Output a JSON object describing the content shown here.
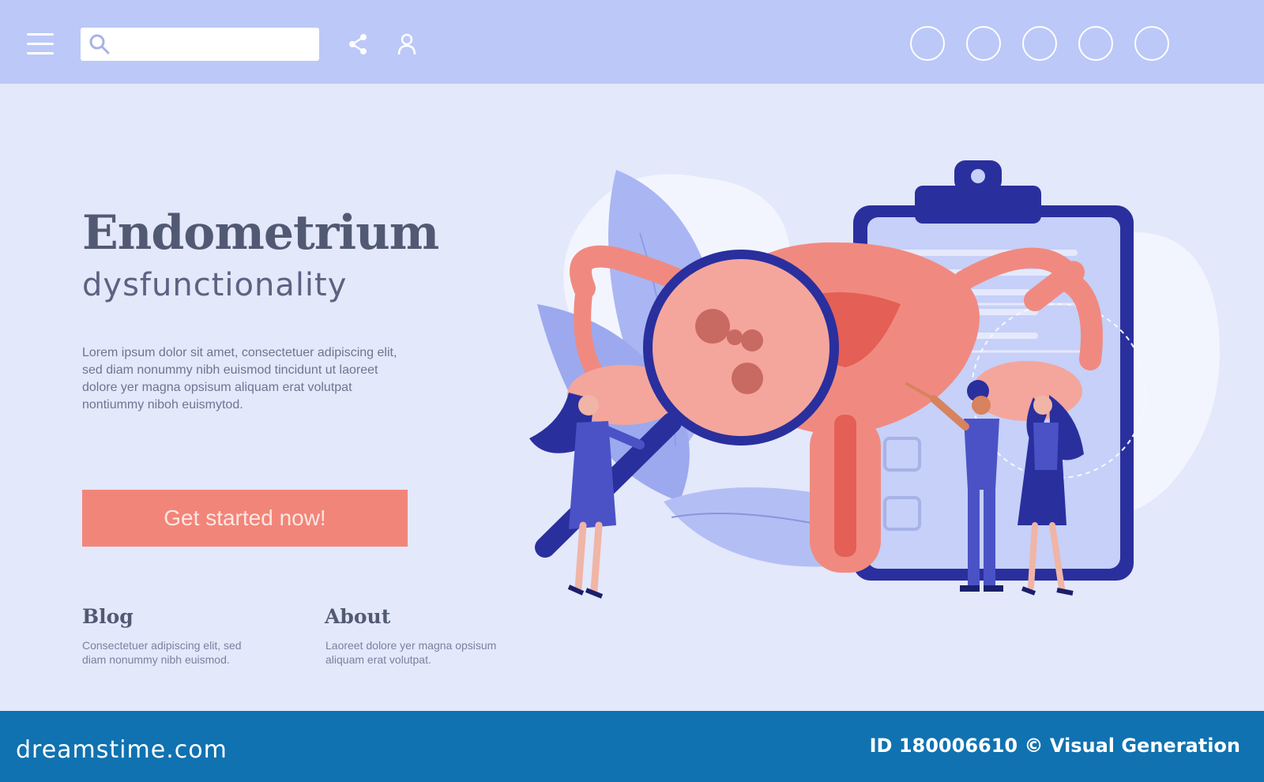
{
  "header": {
    "search_placeholder": "",
    "nav_links_count": 5
  },
  "hero": {
    "title": "Endometrium",
    "subtitle": "dysfunctionality",
    "body": "Lorem ipsum dolor sit amet, consectetuer adipiscing elit, sed diam nonummy nibh euismod tincidunt ut laoreet dolore yer magna opsisum aliquam erat volutpat nontiummy niboh euismytod.",
    "cta_label": "Get started now!"
  },
  "footer_links": {
    "blog_title": "Blog",
    "blog_text": "Consectetuer adipiscing elit, sed diam nonummy nibh euismod.",
    "about_title": "About",
    "about_text": "Laoreet dolore yer magna opsisum aliquam erat volutpat."
  },
  "watermark": {
    "logo": "dreamstime.com",
    "id_text": "ID 180006610 © Visual Generation"
  },
  "colors": {
    "topbar": "#bcc8f8",
    "background": "#e3e8fb",
    "cta": "#f28579",
    "heading": "#525a73",
    "accent_navy": "#2a2f9e",
    "uterus": "#f08a80",
    "watermark_bar": "#1072b0"
  },
  "icons": [
    "hamburger-menu-icon",
    "search-icon",
    "share-icon",
    "user-icon"
  ]
}
